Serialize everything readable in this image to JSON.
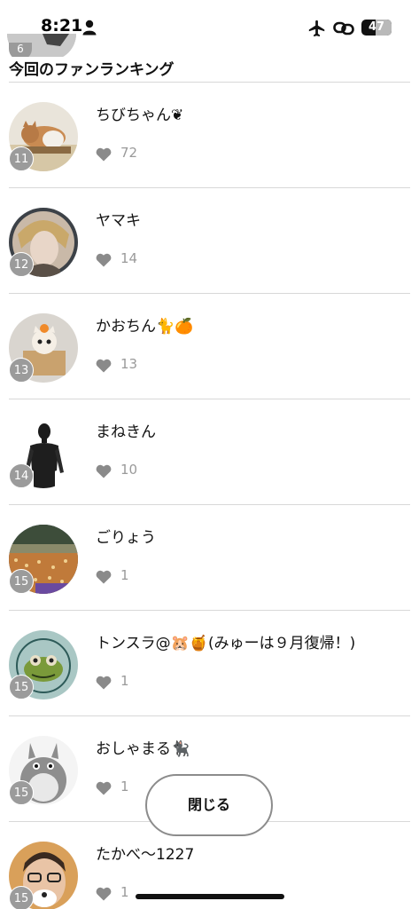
{
  "status_bar": {
    "time": "8:21",
    "battery": "47",
    "icons": [
      "person-icon",
      "airplane-icon",
      "link-icon",
      "battery-icon"
    ]
  },
  "peek": {
    "rank": "6"
  },
  "section_title": "今回のファンランキング",
  "rows": [
    {
      "rank": "11",
      "name": "ちびちゃん❦",
      "count": "72",
      "avatar": "cat-photo"
    },
    {
      "rank": "12",
      "name": "ヤマキ",
      "count": "14",
      "avatar": "anime-character"
    },
    {
      "rank": "13",
      "name": "かおちん🐈🍊",
      "count": "13",
      "avatar": "plush-in-box"
    },
    {
      "rank": "14",
      "name": "まねきん",
      "count": "10",
      "avatar": "mannequin"
    },
    {
      "rank": "15",
      "name": "ごりょう",
      "count": "1",
      "avatar": "concert-crowd"
    },
    {
      "rank": "15",
      "name": "トンスラ@🐹🍯(みゅーは９月復帰！)",
      "count": "1",
      "avatar": "frog-plate"
    },
    {
      "rank": "15",
      "name": "おしゃまる🐈‍⬛",
      "count": "1",
      "avatar": "totoro"
    },
    {
      "rank": "15",
      "name": "たかべ〜1227",
      "count": "1",
      "avatar": "person-face"
    }
  ],
  "close_button": "閉じる",
  "colors": {
    "badge": "#9b9b9b",
    "count_text": "#9a9a9a",
    "heart": "#8a8a8a",
    "divider": "#d8d8d8"
  }
}
